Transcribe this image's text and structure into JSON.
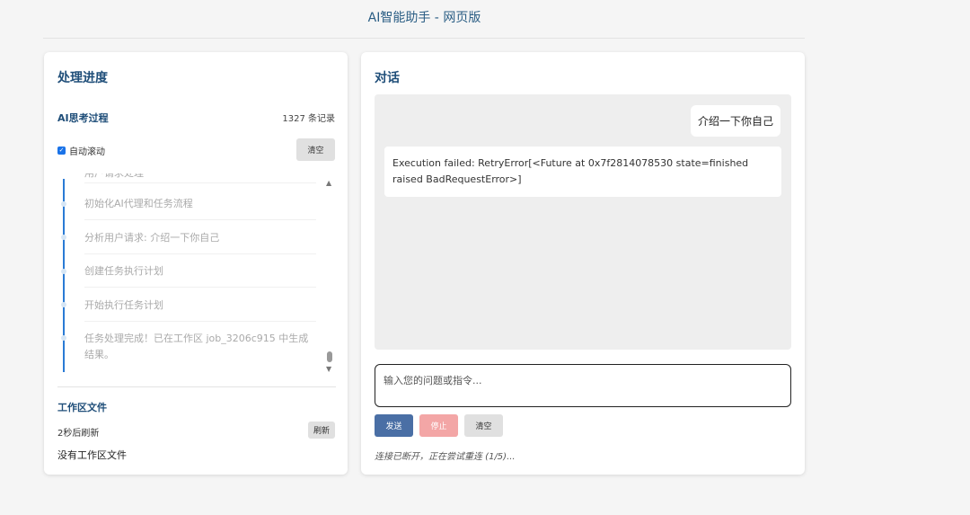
{
  "page": {
    "title": "AI智能助手 - 网页版"
  },
  "progress_panel": {
    "title": "处理进度",
    "thinking": {
      "title": "AI思考过程",
      "record_count": "1327 条记录",
      "auto_scroll_label": "自动滚动",
      "auto_scroll_checked": true,
      "clear_label": "清空",
      "partial_top": "用户请求处理",
      "log_items": [
        "初始化AI代理和任务流程",
        "分析用户请求: 介绍一下你自己",
        "创建任务执行计划",
        "开始执行任务计划",
        "任务处理完成！已在工作区 job_3206c915 中生成结果。"
      ]
    },
    "workspace": {
      "title": "工作区文件",
      "refresh_status": "2秒后刷新",
      "refresh_label": "刷新",
      "empty_text": "没有工作区文件"
    }
  },
  "chat_panel": {
    "title": "对话",
    "messages": [
      {
        "role": "user",
        "text": "介绍一下你自己"
      },
      {
        "role": "assistant",
        "text": "Execution failed: RetryError[<Future at 0x7f2814078530 state=finished raised BadRequestError>]"
      }
    ],
    "input": {
      "placeholder": "输入您的问题或指令..."
    },
    "buttons": {
      "send": "发送",
      "stop": "停止",
      "clear": "清空"
    },
    "status": "连接已断开，正在尝试重连 (1/5)...",
    "colors": {
      "send": "#4a6fa5",
      "stop": "#f3a6a6",
      "clear": "#e0e0e0"
    }
  }
}
